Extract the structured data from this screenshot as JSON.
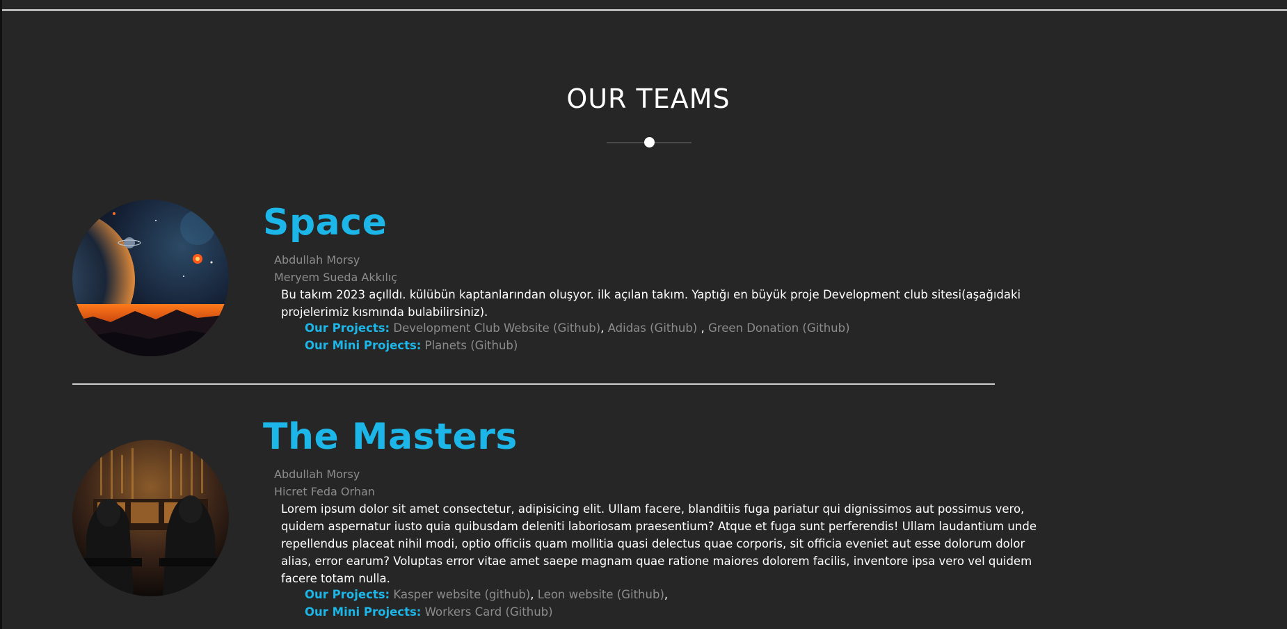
{
  "section": {
    "title": "OUR TEAMS"
  },
  "colors": {
    "accent": "#1cb6e8",
    "background": "#262626",
    "muted": "#8c8c8c"
  },
  "teams": [
    {
      "name": "Space",
      "image_icon": "space-planet-image",
      "members": [
        "Abdullah Morsy",
        "Meryem Sueda Akkılıç"
      ],
      "description": "Bu takım 2023 açılldı. külübün kaptanlarından oluşyor. ilk açılan takım. Yaptığı en büyük proje Development club sitesi(aşağıdaki projelerimiz kısmında bulabilirsiniz).",
      "projects_label": "Our Projects:",
      "projects": [
        "Development Club Website (Github)",
        "Adidas (Github) ",
        "Green Donation (Github)"
      ],
      "mini_projects_label": "Our Mini Projects:",
      "mini_projects": [
        "Planets (Github)"
      ]
    },
    {
      "name": "The Masters",
      "image_icon": "hackers-image",
      "members": [
        "Abdullah Morsy",
        "Hicret Feda Orhan"
      ],
      "description": "Lorem ipsum dolor sit amet consectetur, adipisicing elit. Ullam facere, blanditiis fuga pariatur qui dignissimos aut possimus vero, quidem aspernatur iusto quia quibusdam deleniti laboriosam praesentium? Atque et fuga sunt perferendis! Ullam laudantium unde repellendus placeat nihil modi, optio officiis quam mollitia quasi delectus quae corporis, sit officia eveniet aut esse dolorum dolor alias, error earum? Voluptas error vitae amet saepe magnam quae ratione maiores dolorem facilis, inventore ipsa vero vel quidem facere totam nulla.",
      "projects_label": "Our Projects:",
      "projects": [
        "Kasper website (github)",
        "Leon website (Github)"
      ],
      "mini_projects_label": "Our Mini Projects:",
      "mini_projects": [
        "Workers Card (Github)"
      ]
    }
  ]
}
